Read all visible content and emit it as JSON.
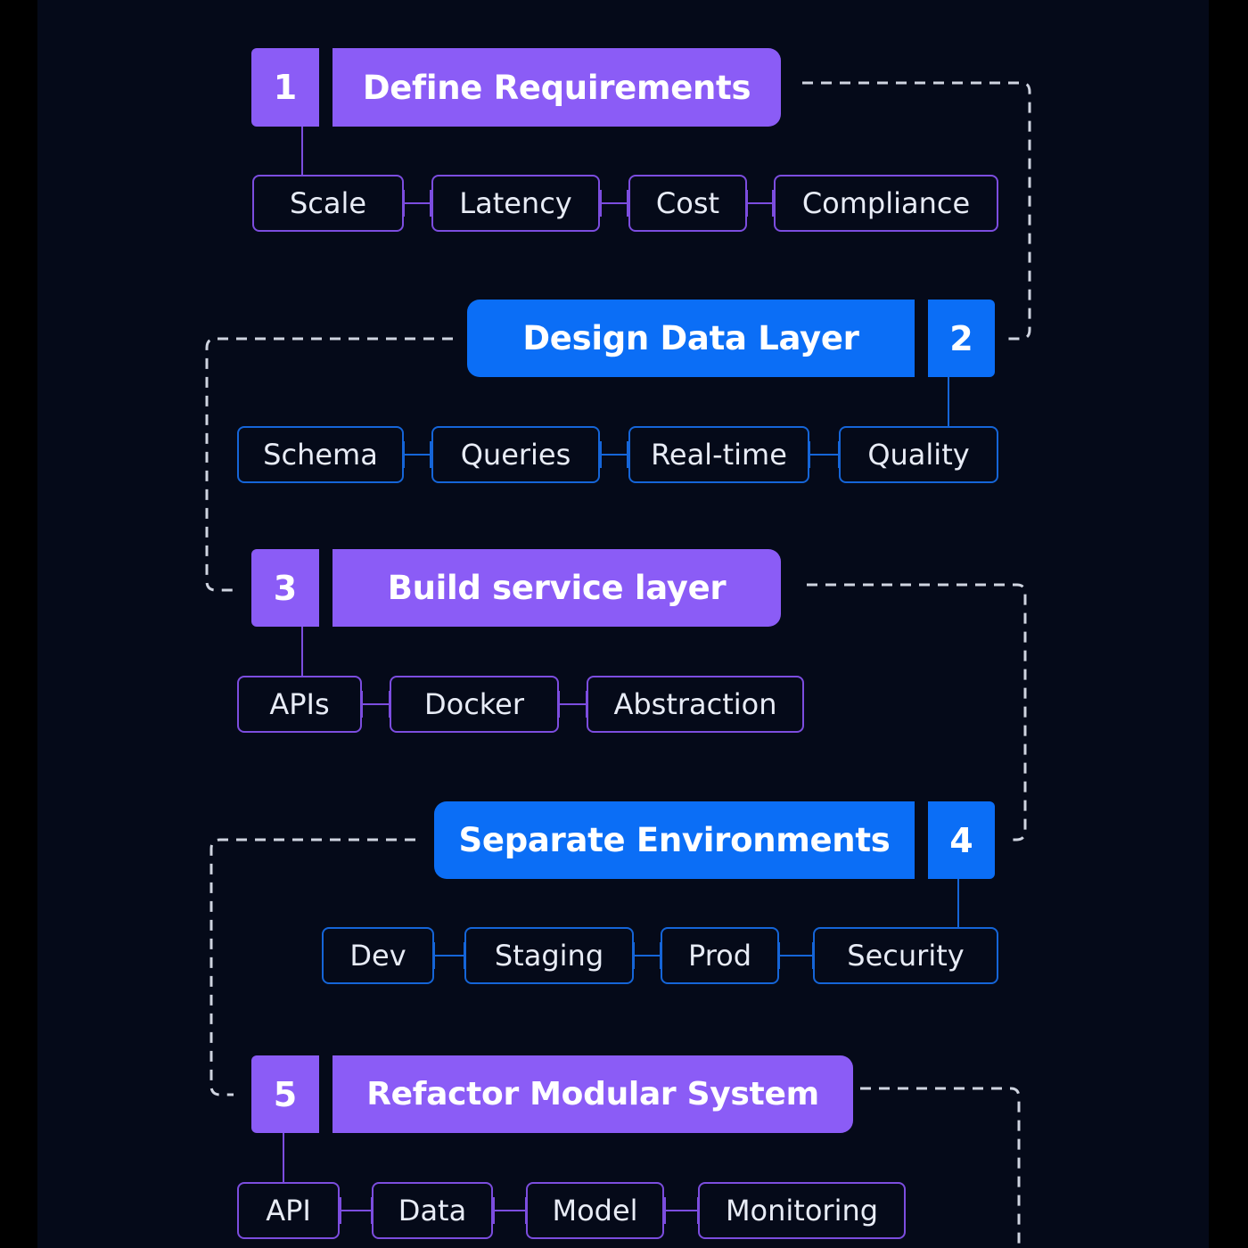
{
  "steps": [
    {
      "number": "1",
      "title": "Define Requirements",
      "color": "#8b5cf6",
      "tags": [
        "Scale",
        "Latency",
        "Cost",
        "Compliance"
      ]
    },
    {
      "number": "2",
      "title": "Design Data Layer",
      "color": "#0b6ef6",
      "tags": [
        "Schema",
        "Queries",
        "Real-time",
        "Quality"
      ]
    },
    {
      "number": "3",
      "title": "Build service layer",
      "color": "#8b5cf6",
      "tags": [
        "APIs",
        "Docker",
        "Abstraction"
      ]
    },
    {
      "number": "4",
      "title": "Separate Environments",
      "color": "#0b6ef6",
      "tags": [
        "Dev",
        "Staging",
        "Prod",
        "Security"
      ]
    },
    {
      "number": "5",
      "title": "Refactor Modular System",
      "color": "#8b5cf6",
      "tags": [
        "API",
        "Data",
        "Model",
        "Monitoring"
      ]
    }
  ],
  "colors": {
    "background": "#050a19",
    "purple": "#8b5cf6",
    "blue": "#0b6ef6",
    "purple_border": "#7c4ddf",
    "blue_border": "#1565d8",
    "dashed_line": "#cfd4e0"
  }
}
